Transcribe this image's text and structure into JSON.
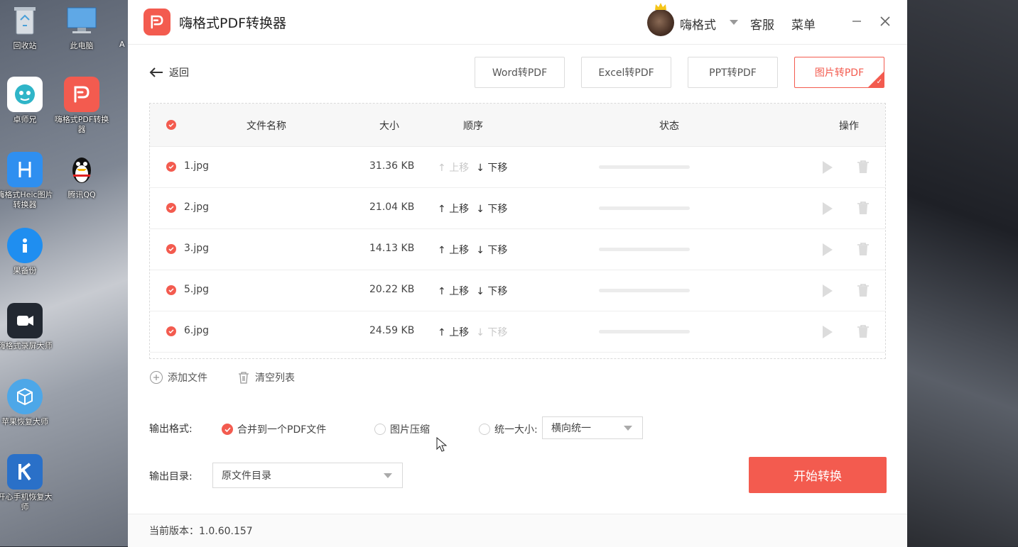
{
  "desktop": {
    "icons": [
      {
        "label": "回收站",
        "icon": "recycle-bin-icon",
        "color": "#8d9aa8"
      },
      {
        "label": "此电脑",
        "icon": "computer-icon",
        "color": "#4a86c8"
      },
      {
        "label": "卓师兄",
        "icon": "zhuoshixiong-icon",
        "color": "#2fb5c8"
      },
      {
        "label": "嗨格式PDF转换器",
        "icon": "pdf-converter-icon",
        "color": "#f35b4f"
      },
      {
        "label": "嗨格式Heic图片转换器",
        "icon": "heic-converter-icon",
        "color": "#2f8ff0"
      },
      {
        "label": "腾讯QQ",
        "icon": "qq-penguin-icon",
        "color": "#ffffff"
      },
      {
        "label": "果备份",
        "icon": "backup-icon",
        "color": "#1f8ef0"
      },
      {
        "label": "嗨格式录屏大师",
        "icon": "screen-recorder-icon",
        "color": "#222831"
      },
      {
        "label": "苹果恢复大师",
        "icon": "apple-recovery-icon",
        "color": "#4da7e8"
      },
      {
        "label": "开心手机恢复大师",
        "icon": "phone-recovery-icon",
        "color": "#2a70c8"
      }
    ],
    "clipped_label": "A"
  },
  "app": {
    "title": "嗨格式PDF转换器",
    "user_name": "嗨格式",
    "service": "客服",
    "menu": "菜单",
    "back": "返回",
    "accent": "#f35b4f"
  },
  "tabs": [
    {
      "label": "Word转PDF",
      "active": false
    },
    {
      "label": "Excel转PDF",
      "active": false
    },
    {
      "label": "PPT转PDF",
      "active": false
    },
    {
      "label": "图片转PDF",
      "active": true
    }
  ],
  "table": {
    "headers": {
      "name": "文件名称",
      "size": "大小",
      "order": "顺序",
      "status": "状态",
      "action": "操作"
    },
    "move_up": "上移",
    "move_down": "下移",
    "rows": [
      {
        "name": "1.jpg",
        "size": "31.36 KB",
        "up_enabled": false,
        "down_enabled": true
      },
      {
        "name": "2.jpg",
        "size": "21.04 KB",
        "up_enabled": true,
        "down_enabled": true
      },
      {
        "name": "3.jpg",
        "size": "14.13 KB",
        "up_enabled": true,
        "down_enabled": true
      },
      {
        "name": "5.jpg",
        "size": "20.22 KB",
        "up_enabled": true,
        "down_enabled": true
      },
      {
        "name": "6.jpg",
        "size": "24.59 KB",
        "up_enabled": true,
        "down_enabled": false
      }
    ]
  },
  "toolbar": {
    "add": "添加文件",
    "clear": "清空列表"
  },
  "output": {
    "format_label": "输出格式:",
    "options": {
      "merge": "合并到一个PDF文件",
      "compress": "图片压缩",
      "uniform": "统一大小:"
    },
    "selected": "merge",
    "uniform_select": "横向统一",
    "dir_label": "输出目录:",
    "dir_select": "原文件目录",
    "start": "开始转换"
  },
  "footer": {
    "version": "当前版本：1.0.60.157"
  }
}
